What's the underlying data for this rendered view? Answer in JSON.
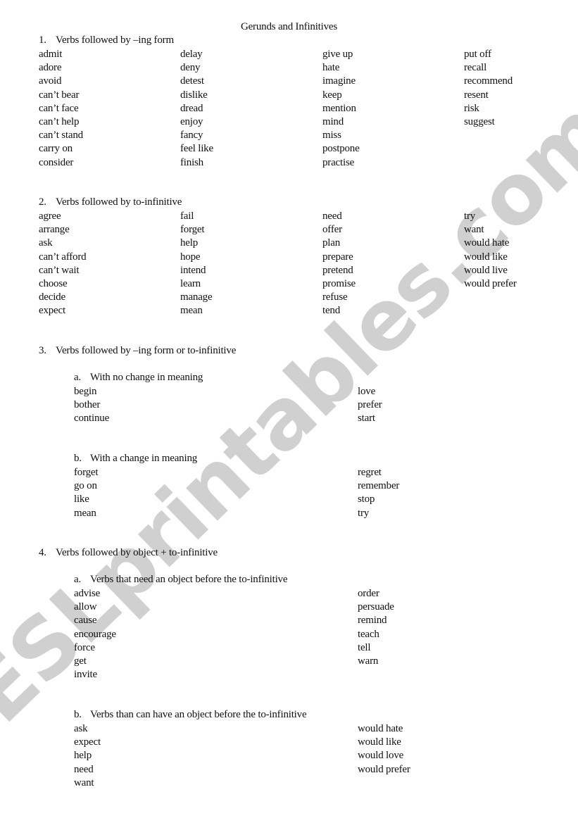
{
  "title": "Gerunds and Infinitives",
  "watermark": "ESLprintables.com",
  "section1": {
    "num": "1.",
    "heading": "Verbs followed by –ing form",
    "columns": [
      [
        "admit",
        "adore",
        "avoid",
        "can’t bear",
        "can’t face",
        "can’t help",
        "can’t stand",
        "carry on",
        "consider"
      ],
      [
        "delay",
        "deny",
        "detest",
        "dislike",
        "dread",
        "enjoy",
        "fancy",
        "feel like",
        "finish"
      ],
      [
        "give up",
        "hate",
        "imagine",
        "keep",
        "mention",
        "mind",
        "miss",
        "postpone",
        "practise"
      ],
      [
        "put off",
        "recall",
        "recommend",
        "resent",
        "risk",
        "suggest"
      ]
    ]
  },
  "section2": {
    "num": "2.",
    "heading": "Verbs followed by to-infinitive",
    "columns": [
      [
        "agree",
        "arrange",
        "ask",
        "can’t afford",
        "can’t wait",
        "choose",
        "decide",
        "expect"
      ],
      [
        "fail",
        "forget",
        "help",
        "hope",
        "intend",
        "learn",
        "manage",
        "mean"
      ],
      [
        "need",
        "offer",
        "plan",
        "prepare",
        "pretend",
        "promise",
        "refuse",
        "tend"
      ],
      [
        "try",
        "want",
        "would hate",
        "would like",
        "would live",
        "would prefer"
      ]
    ]
  },
  "section3": {
    "num": "3.",
    "heading": "Verbs followed by –ing form or to-infinitive",
    "a": {
      "num": "a.",
      "heading": "With no change in meaning",
      "columns": [
        [
          "begin",
          "bother",
          "continue"
        ],
        [
          "love",
          "prefer",
          "start"
        ]
      ]
    },
    "b": {
      "num": "b.",
      "heading": "With a change in meaning",
      "columns": [
        [
          "forget",
          "go on",
          "like",
          "mean"
        ],
        [
          "regret",
          "remember",
          "stop",
          "try"
        ]
      ]
    }
  },
  "section4": {
    "num": "4.",
    "heading": "Verbs followed by object + to-infinitive",
    "a": {
      "num": "a.",
      "heading": "Verbs that need an object before the to-infinitive",
      "columns": [
        [
          "advise",
          "allow",
          "cause",
          "encourage",
          "force",
          "get",
          "invite"
        ],
        [
          "order",
          "persuade",
          "remind",
          "teach",
          "tell",
          "warn"
        ]
      ]
    },
    "b": {
      "num": "b.",
      "heading": "Verbs than can have an object before the to-infinitive",
      "columns": [
        [
          "ask",
          "expect",
          "help",
          "need",
          "want"
        ],
        [
          "would hate",
          "would like",
          "would love",
          "would prefer"
        ]
      ]
    }
  }
}
